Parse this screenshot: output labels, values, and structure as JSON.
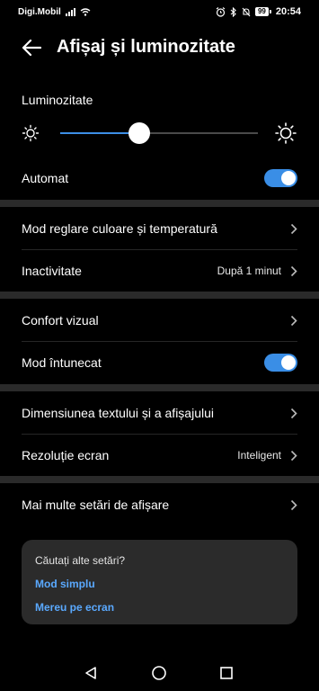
{
  "status_bar": {
    "carrier": "Digi.Mobil",
    "battery": "99",
    "time": "20:54"
  },
  "header": {
    "title": "Afișaj și luminozitate"
  },
  "brightness": {
    "label": "Luminozitate",
    "level": 0.4
  },
  "auto": {
    "label": "Automat",
    "on": true
  },
  "rows": {
    "color_mode": {
      "label": "Mod reglare culoare și temperatură"
    },
    "sleep": {
      "label": "Inactivitate",
      "value": "După 1 minut"
    },
    "eye_comfort": {
      "label": "Confort vizual"
    },
    "dark_mode": {
      "label": "Mod întunecat",
      "on": true
    },
    "text_size": {
      "label": "Dimensiunea textului și a afișajului"
    },
    "resolution": {
      "label": "Rezoluție ecran",
      "value": "Inteligent"
    },
    "more": {
      "label": "Mai multe setări de afișare"
    }
  },
  "suggestion_card": {
    "title": "Căutați alte setări?",
    "links": [
      "Mod simplu",
      "Mereu pe ecran"
    ]
  },
  "colors": {
    "accent": "#3a8ee6",
    "link": "#5aa9ff",
    "background": "#000000",
    "card": "#2b2b2b"
  }
}
